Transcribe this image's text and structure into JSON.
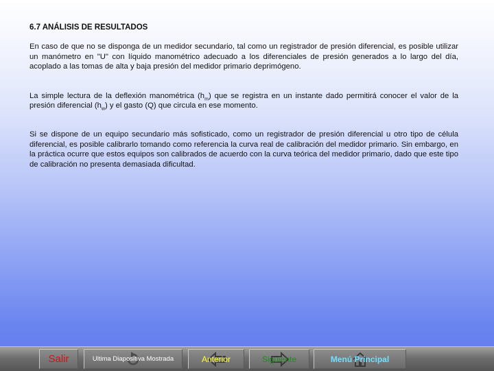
{
  "slide": {
    "title": "6.7 ANÁLISIS DE RESULTADOS",
    "paragraph1": "En caso de que no se disponga de un medidor secundario, tal como un registrador de presión diferencial, es posible utilizar un manómetro en \"U\" con líquido manométrico adecuado a los diferenciales de presión generados a lo largo del día, acoplado a las tomas de alta y baja presión del medidor primario deprimógeno.",
    "paragraph2": {
      "part1": "La simple lectura de la deflexión manométrica (h",
      "sub1": "m",
      "part2": ") que se registra en un instante dado permitirá conocer el valor de la presión diferencial (h",
      "sub2": "w",
      "part3": ") y el gasto (Q) que circula en ese momento."
    },
    "paragraph3": "Si se dispone de un equipo secundario más sofisticado, como un registrador de presión diferencial u otro tipo de célula diferencial, es posible calibrarlo tomando como referencia la curva real de calibración del medidor primario. Sin embargo, en la práctica ocurre que estos equipos son calibrados de acuerdo con la curva teórica del medidor primario, dado que este tipo de calibración no presenta demasiada dificultad."
  },
  "toolbar": {
    "salir": "Salir",
    "ultima": "Ultima Diapositiva Mostrada",
    "anterior": "Anterior",
    "siguiente": "Siguiente",
    "menu": "Menú Principal"
  },
  "colors": {
    "salir": "#c81818",
    "anterior": "#ffff3a",
    "siguiente": "#1e8c1e",
    "menu": "#70e0ff"
  },
  "icons": [
    "return-arrow-icon",
    "left-arrow-icon",
    "right-arrow-icon",
    "home-icon"
  ]
}
